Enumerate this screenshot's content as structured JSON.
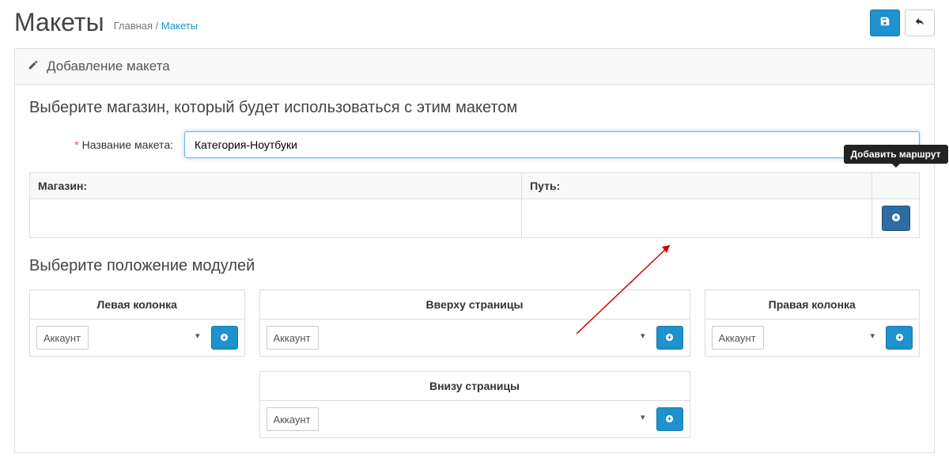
{
  "header": {
    "title": "Макеты",
    "breadcrumb_home": "Главная",
    "breadcrumb_sep": " / ",
    "breadcrumb_current": "Макеты"
  },
  "panel": {
    "heading": "Добавление макета",
    "section1_title": "Выберите магазин, который будет использоваться с этим макетом",
    "name_label": "Название макета:",
    "name_value": "Категория-Ноутбуки",
    "table": {
      "col_store": "Магазин:",
      "col_route": "Путь:",
      "add_tooltip": "Добавить маршрут"
    },
    "section2_title": "Выберите положение модулей",
    "columns": {
      "left": "Левая колонка",
      "top": "Вверху страницы",
      "right": "Правая колонка",
      "bottom": "Внизу страницы"
    },
    "select_value": "Аккаунт"
  }
}
